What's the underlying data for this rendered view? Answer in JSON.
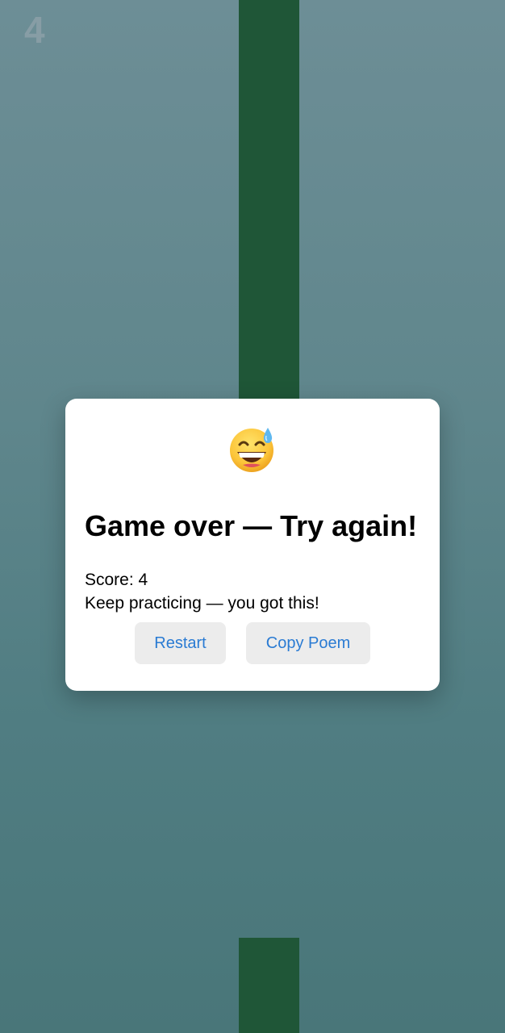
{
  "game": {
    "score_display": "4"
  },
  "modal": {
    "emoji": "grinning-face-with-sweat-icon",
    "title": "Game over — Try again!",
    "score_text": "Score: 4",
    "message": "Keep practicing — you got this!",
    "buttons": {
      "restart_label": "Restart",
      "copy_poem_label": "Copy Poem"
    }
  },
  "colors": {
    "pipe": "#1f5637",
    "background_top": "#6d8e96",
    "background_bottom": "#497679",
    "button_text": "#2a7bd3",
    "button_bg": "#ececec"
  }
}
